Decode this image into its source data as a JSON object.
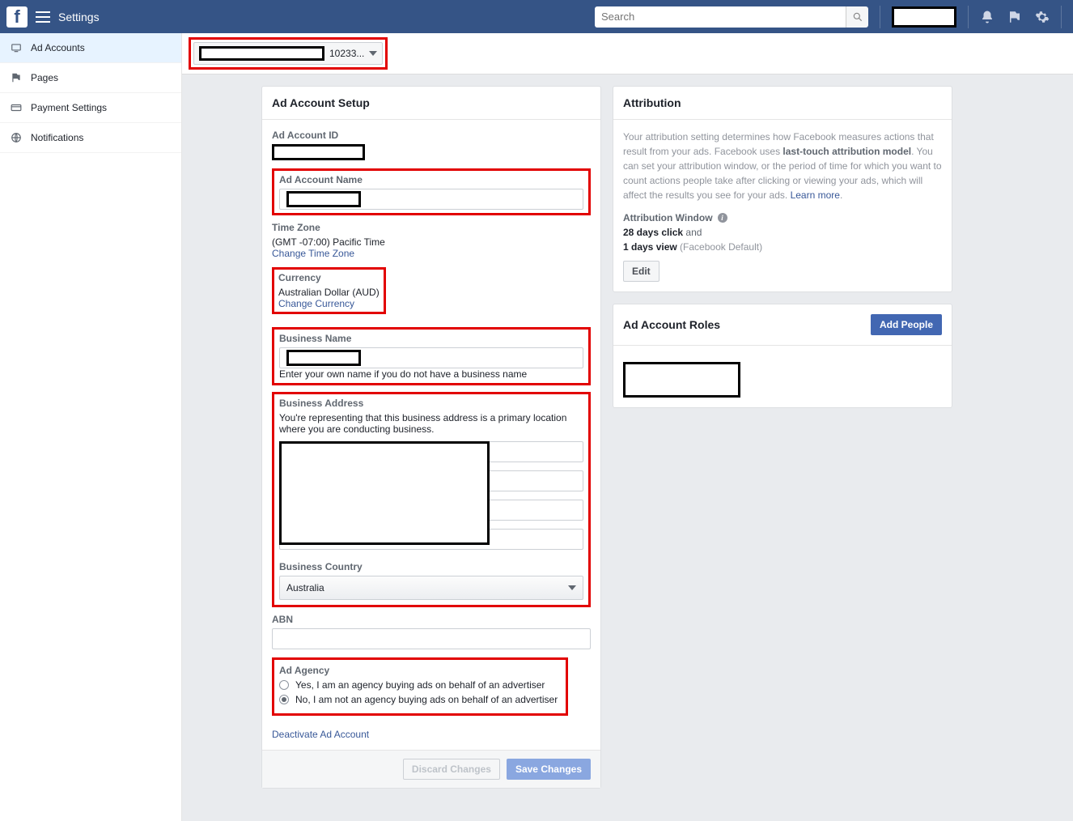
{
  "topbar": {
    "title": "Settings",
    "search_placeholder": "Search"
  },
  "sidebar": {
    "items": [
      {
        "label": "Ad Accounts"
      },
      {
        "label": "Pages"
      },
      {
        "label": "Payment Settings"
      },
      {
        "label": "Notifications"
      }
    ]
  },
  "account_selector": {
    "id_fragment": "10233..."
  },
  "setup": {
    "title": "Ad Account Setup",
    "ad_account_id_label": "Ad Account ID",
    "ad_account_name_label": "Ad Account Name",
    "timezone_label": "Time Zone",
    "timezone_value": "(GMT -07:00) Pacific Time",
    "change_timezone": "Change Time Zone",
    "currency_label": "Currency",
    "currency_value": "Australian Dollar (AUD)",
    "change_currency": "Change Currency",
    "business_name_label": "Business Name",
    "business_name_hint": "Enter your own name if you do not have a business name",
    "business_address_label": "Business Address",
    "business_address_hint": "You're representing that this business address is a primary location where you are conducting business.",
    "business_country_label": "Business Country",
    "business_country_value": "Australia",
    "abn_label": "ABN",
    "agency_label": "Ad Agency",
    "agency_yes": "Yes, I am an agency buying ads on behalf of an advertiser",
    "agency_no": "No, I am not an agency buying ads on behalf of an advertiser",
    "deactivate": "Deactivate Ad Account",
    "discard": "Discard Changes",
    "save": "Save Changes"
  },
  "attribution": {
    "title": "Attribution",
    "desc_pre": "Your attribution setting determines how Facebook measures actions that result from your ads. Facebook uses ",
    "desc_bold": "last-touch attribution model",
    "desc_post": ". You can set your attribution window, or the period of time for which you want to count actions people take after clicking or viewing your ads, which will affect the results you see for your ads. ",
    "learn_more": "Learn more",
    "window_label": "Attribution Window",
    "click_days": "28 days click",
    "and": " and",
    "view_days": "1 days view",
    "default": " (Facebook Default)",
    "edit": "Edit"
  },
  "roles": {
    "title": "Ad Account Roles",
    "add_people": "Add People"
  }
}
